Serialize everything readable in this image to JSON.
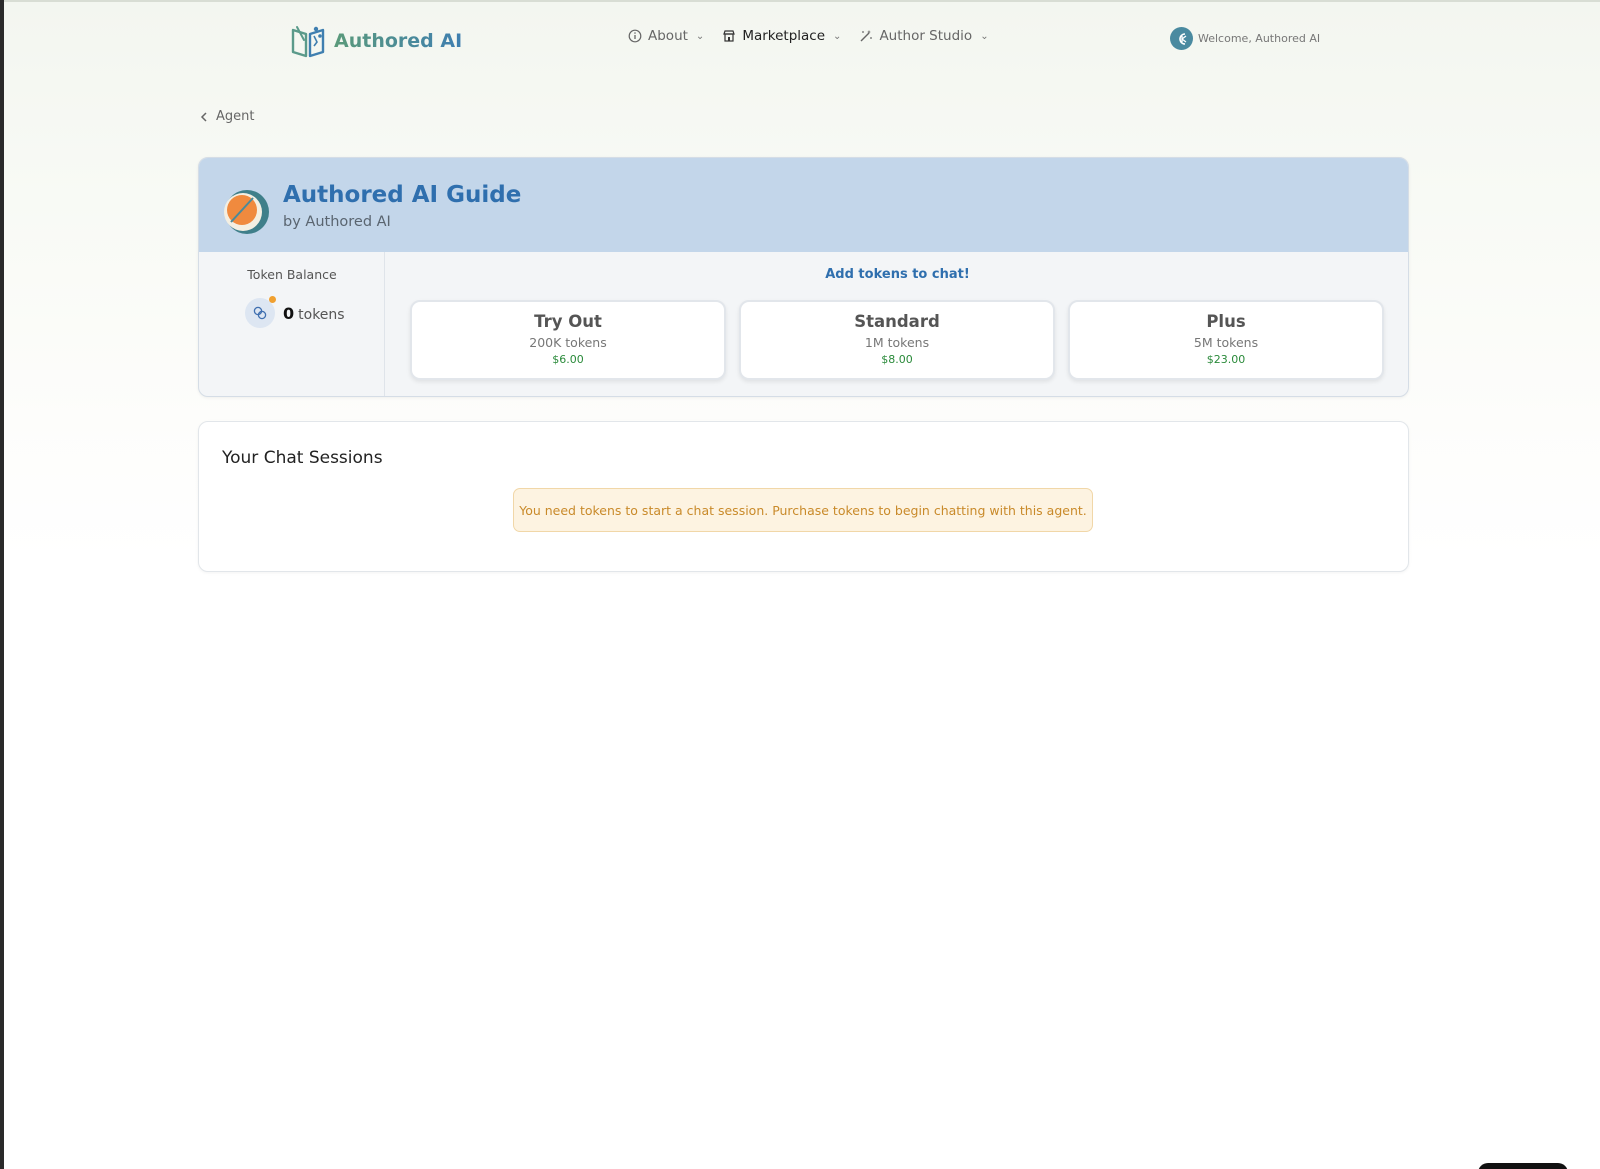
{
  "header": {
    "logo_text": "Authored AI",
    "nav": [
      {
        "label": "About",
        "icon": "info-icon"
      },
      {
        "label": "Marketplace",
        "icon": "store-icon"
      },
      {
        "label": "Author Studio",
        "icon": "wand-icon"
      }
    ],
    "welcome": "Welcome, Authored AI"
  },
  "breadcrumb": {
    "back_label": "Agent"
  },
  "agent": {
    "title": "Authored AI Guide",
    "byline": "by Authored AI"
  },
  "balance": {
    "label": "Token Balance",
    "count": "0",
    "unit": "tokens"
  },
  "plans": {
    "heading": "Add tokens to chat!",
    "items": [
      {
        "name": "Try Out",
        "tokens": "200K tokens",
        "price": "$6.00"
      },
      {
        "name": "Standard",
        "tokens": "1M tokens",
        "price": "$8.00"
      },
      {
        "name": "Plus",
        "tokens": "5M tokens",
        "price": "$23.00"
      }
    ]
  },
  "sessions": {
    "title": "Your Chat Sessions",
    "notice": "You need tokens to start a chat session. Purchase tokens to begin chatting with this agent."
  },
  "colors": {
    "accent": "#2f6fae",
    "price_green": "#2a8a3a",
    "warning": "#c98a2a"
  }
}
